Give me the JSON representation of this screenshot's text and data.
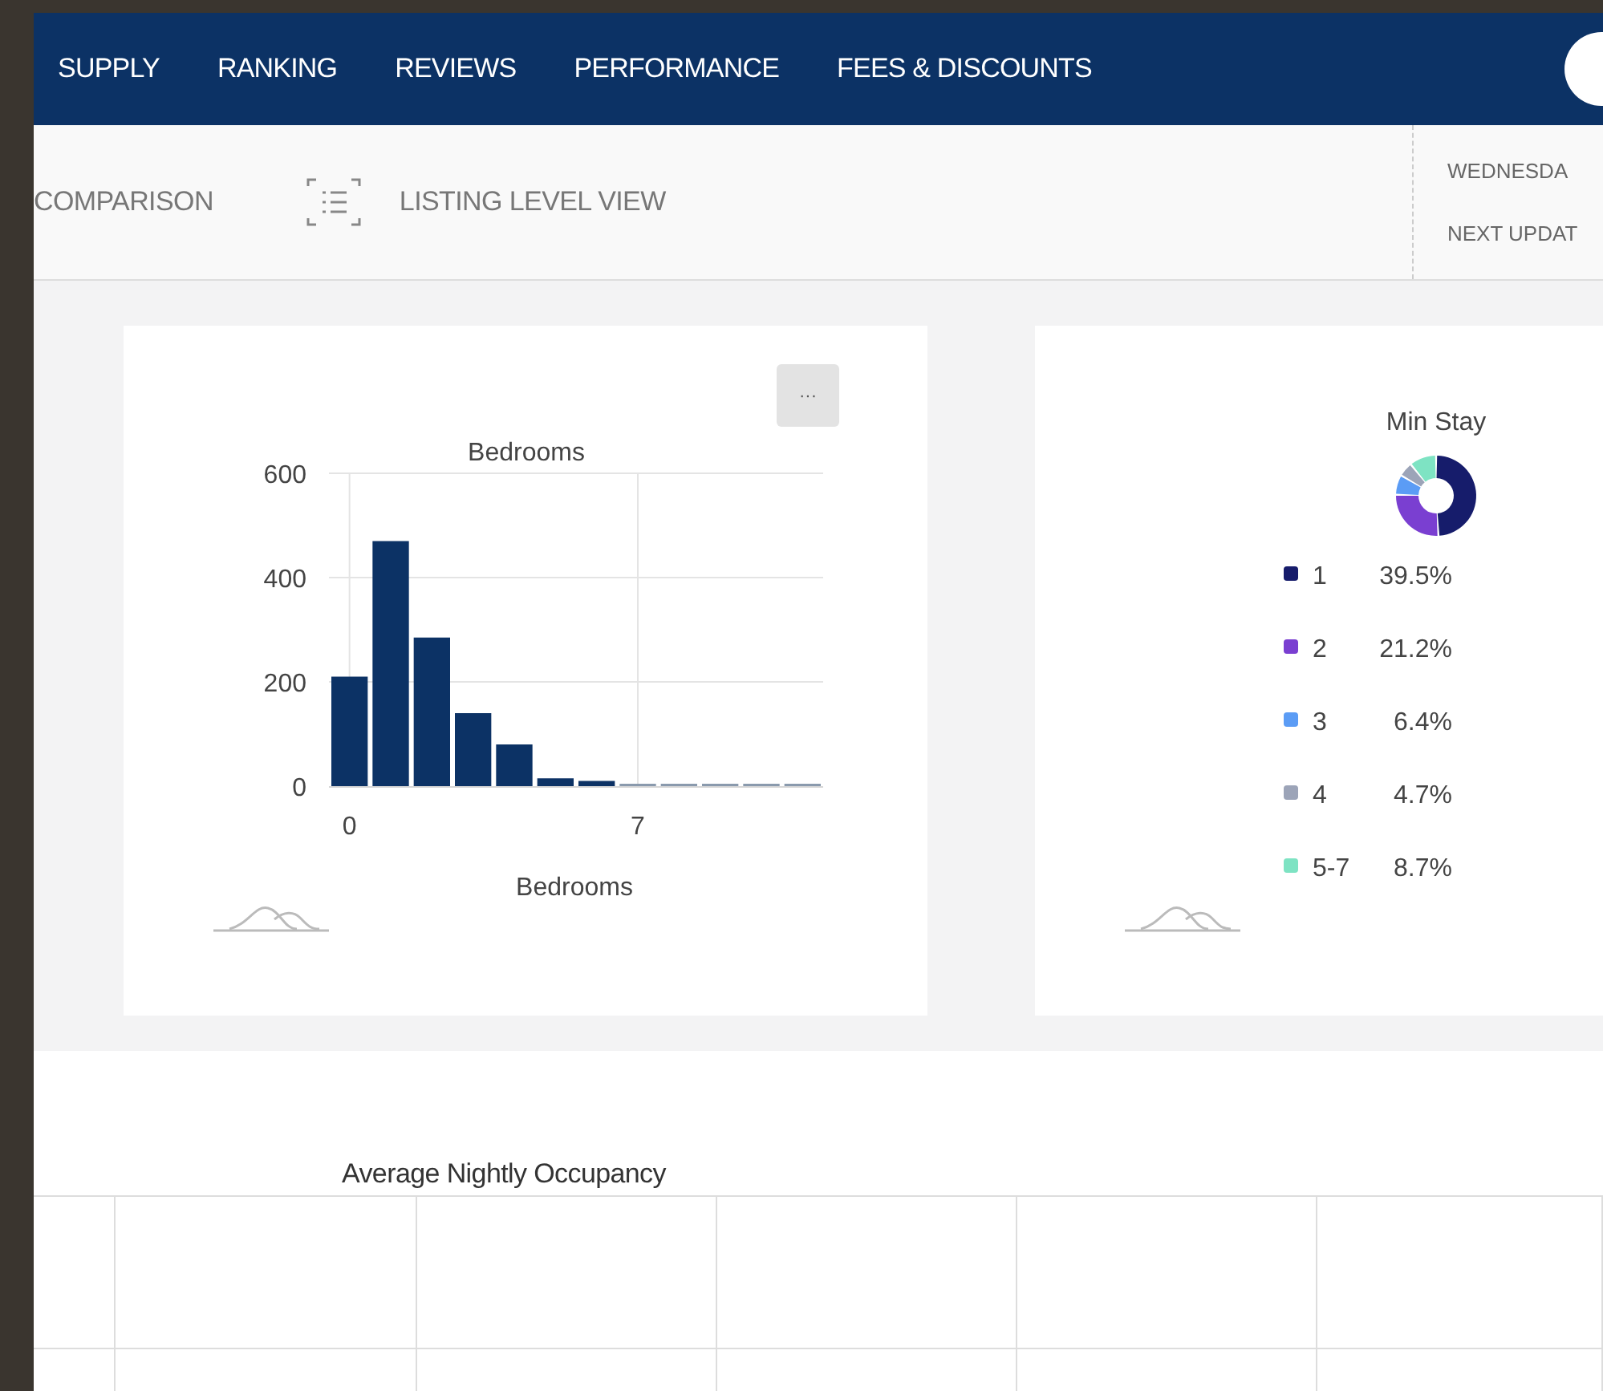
{
  "nav": {
    "items": [
      {
        "label": "SUPPLY"
      },
      {
        "label": "RANKING"
      },
      {
        "label": "REVIEWS"
      },
      {
        "label": "PERFORMANCE"
      },
      {
        "label": "FEES & DISCOUNTS"
      }
    ]
  },
  "toolbar": {
    "views": [
      {
        "label": "COMPARISON",
        "kind": "plain"
      },
      {
        "label": "LISTING LEVEL VIEW",
        "kind": "list"
      }
    ],
    "update_info": [
      "WEDNESDA",
      "NEXT UPDAT"
    ]
  },
  "cards": [
    {
      "menu_label": "···",
      "chart_data": {
        "type": "bar",
        "title": "Bedrooms",
        "xlabel": "Bedrooms",
        "x": [
          0,
          1,
          2,
          3,
          4,
          5,
          6,
          7,
          8,
          9,
          10,
          11
        ],
        "values": [
          210,
          470,
          285,
          140,
          80,
          15,
          10,
          2,
          2,
          2,
          2,
          2
        ],
        "ylim": [
          0,
          600
        ],
        "yticks": [
          0,
          200,
          400,
          600
        ],
        "xlim": [
          -0.5,
          11.5
        ],
        "xticks": [
          0,
          7
        ],
        "grid": true
      }
    },
    {
      "chart_data": {
        "type": "donut",
        "title": "Min Stay",
        "legend": true,
        "categories": [
          "1",
          "2",
          "3",
          "4",
          "5-7"
        ],
        "values": [
          39.5,
          21.2,
          6.4,
          4.7,
          8.7
        ],
        "value_labels": [
          "39.5%",
          "21.2%",
          "6.4%",
          "4.7%",
          "8.7%"
        ],
        "colors": [
          "#161c6b",
          "#7a3fd1",
          "#5b9cf5",
          "#9ca4b8",
          "#7ee3c3"
        ]
      }
    }
  ],
  "occupancy": {
    "title": "Average Nightly Occupancy"
  }
}
